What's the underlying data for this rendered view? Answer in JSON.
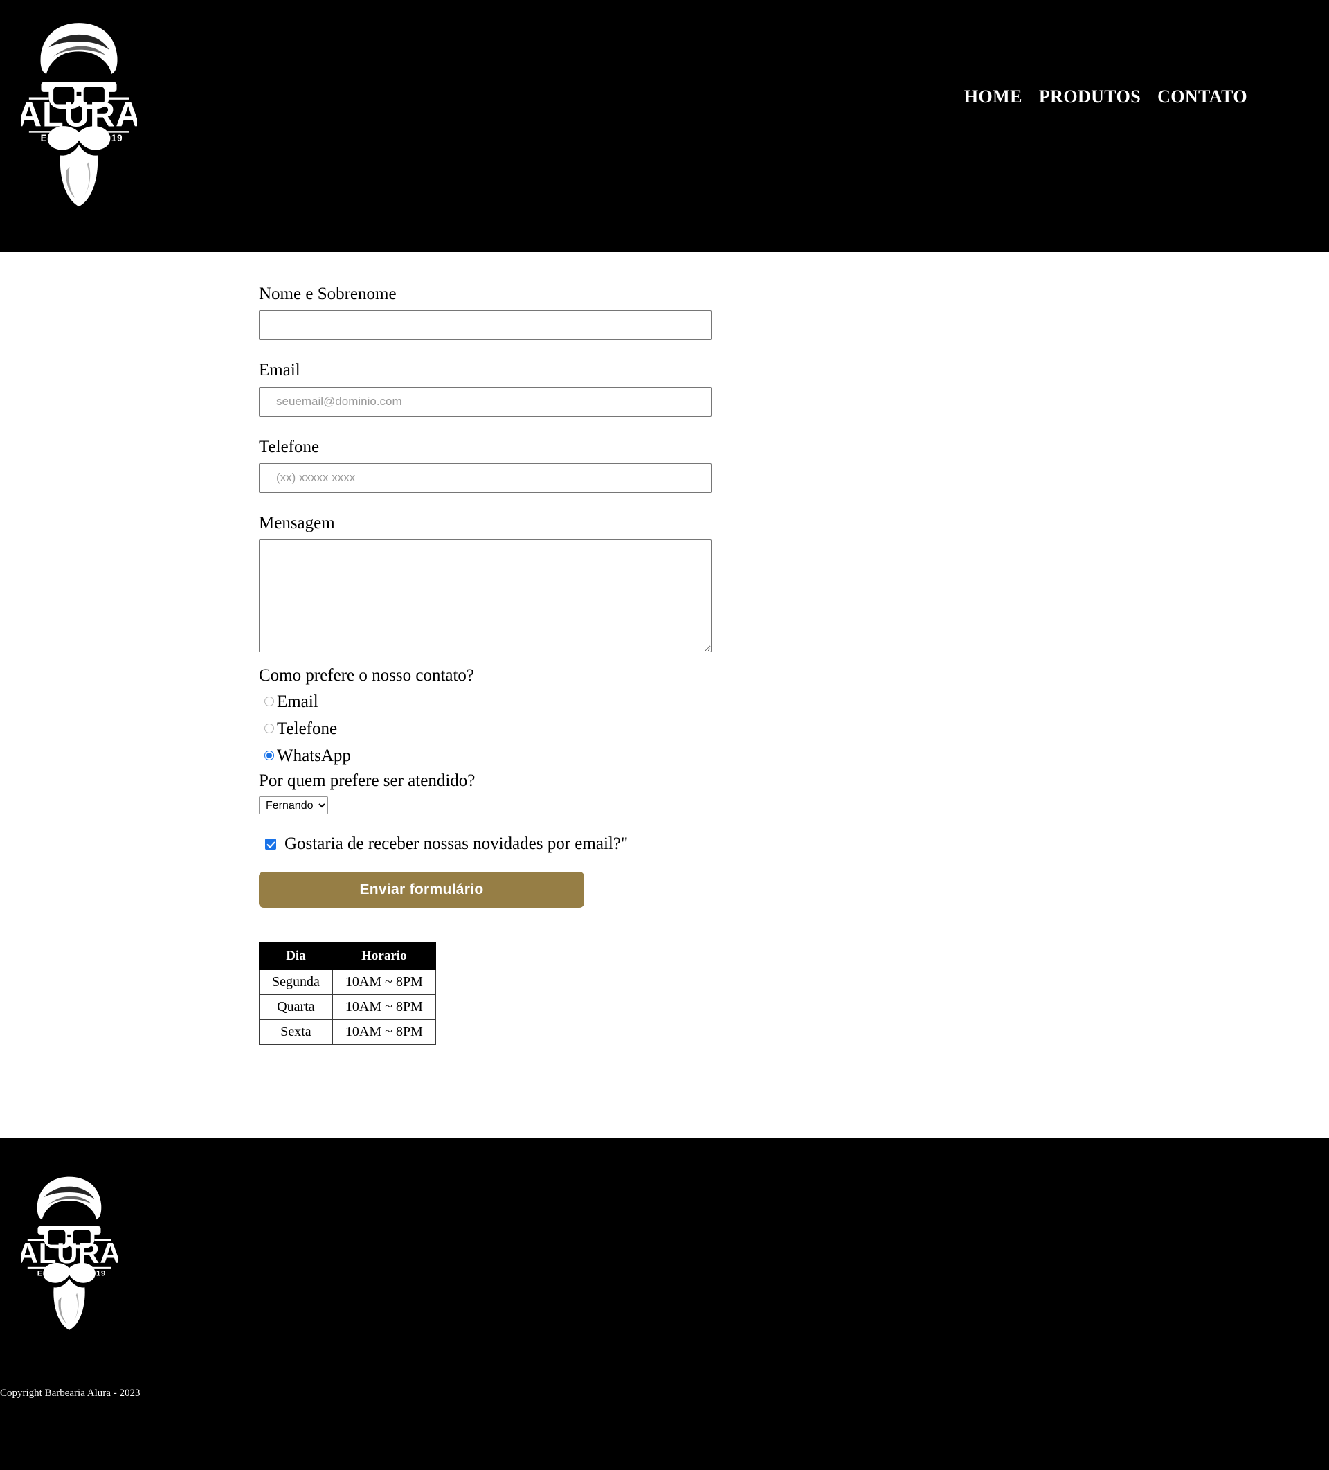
{
  "brand": {
    "logo_name": "ALURA",
    "logo_estd": "ESTD",
    "logo_year": "2019",
    "logo_alt": "barbershop-face-logo"
  },
  "header": {
    "background": "#000000",
    "nav": [
      {
        "label": "HOME",
        "name": "nav-home"
      },
      {
        "label": "PRODUTOS",
        "name": "nav-produtos"
      },
      {
        "label": "CONTATO",
        "name": "nav-contato"
      }
    ]
  },
  "form": {
    "name_field": {
      "label": "Nome e Sobrenome",
      "value": "",
      "placeholder": ""
    },
    "email_field": {
      "label": "Email",
      "value": "",
      "placeholder": "seuemail@dominio.com"
    },
    "phone_field": {
      "label": "Telefone",
      "value": "",
      "placeholder": "(xx) xxxxx xxxx"
    },
    "message_field": {
      "label": "Mensagem",
      "value": "",
      "placeholder": ""
    },
    "contact_preference": {
      "question": "Como prefere o nosso contato?",
      "options": [
        {
          "label": "Email",
          "selected": false
        },
        {
          "label": "Telefone",
          "selected": false
        },
        {
          "label": "WhatsApp",
          "selected": true
        }
      ]
    },
    "attendant": {
      "question": "Por quem prefere ser atendido?",
      "selected": "Fernando",
      "options": [
        "Fernando"
      ]
    },
    "newsletter": {
      "label": "Gostaria de receber nossas novidades por email?\"",
      "checked": true
    },
    "submit_label": "Enviar formulário",
    "submit_color": "#967e45"
  },
  "hours_table": {
    "headers": [
      "Dia",
      "Horario"
    ],
    "rows": [
      [
        "Segunda",
        "10AM ~ 8PM"
      ],
      [
        "Quarta",
        "10AM ~ 8PM"
      ],
      [
        "Sexta",
        "10AM ~ 8PM"
      ]
    ]
  },
  "footer": {
    "background": "#000000",
    "copyright": "Copyright Barbearia Alura - 2023"
  }
}
